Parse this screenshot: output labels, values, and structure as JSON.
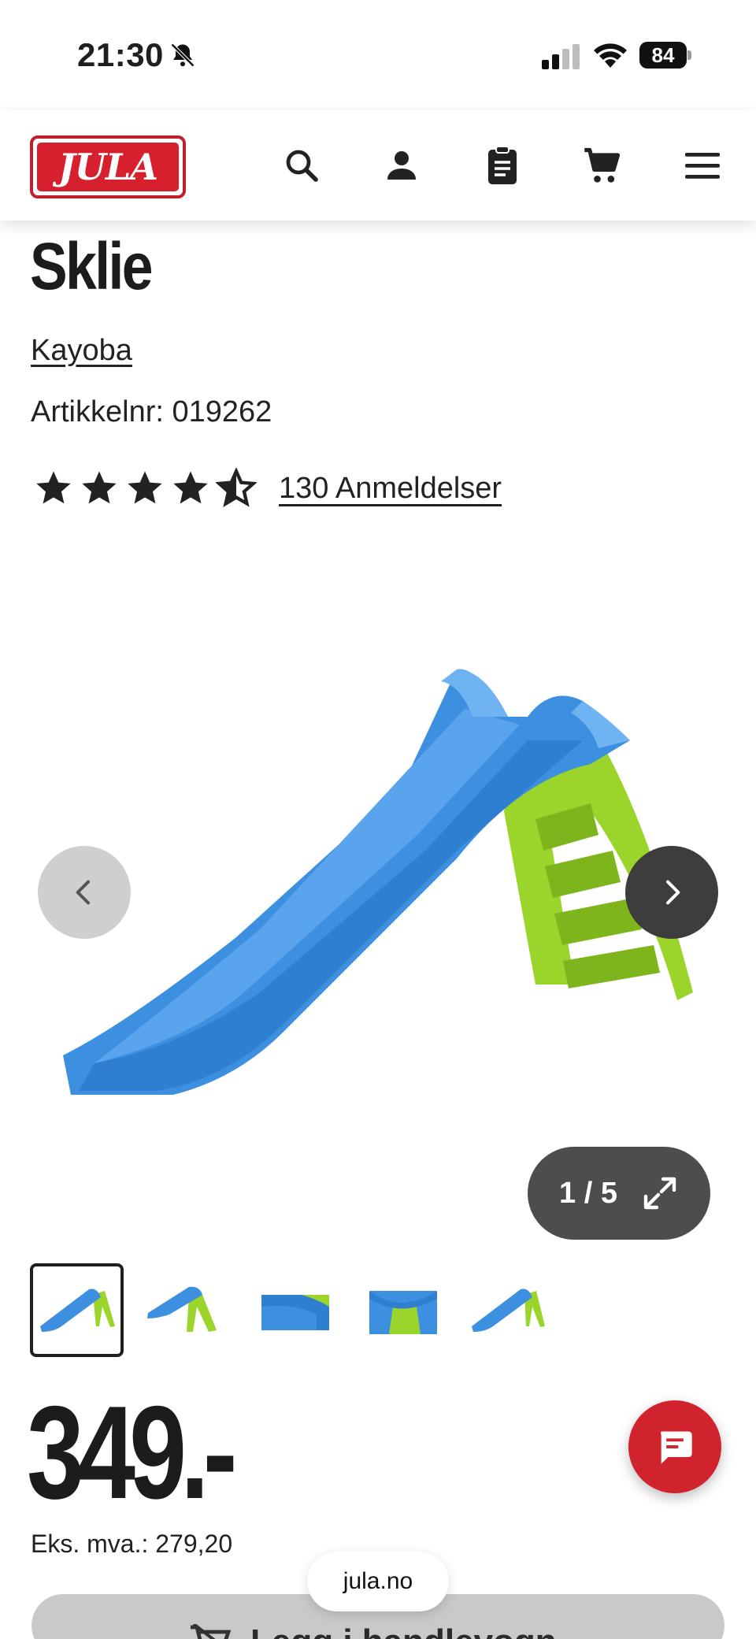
{
  "status_bar": {
    "time": "21:30",
    "battery": "84"
  },
  "header": {
    "logo_text": "JULA",
    "icons": [
      "search-icon",
      "account-icon",
      "clipboard-icon",
      "cart-icon",
      "menu-icon"
    ]
  },
  "product": {
    "title": "Sklie",
    "brand": "Kayoba",
    "article_number": "Artikkelnr: 019262",
    "rating_value": 4.5,
    "rating_max": 5,
    "reviews_label": "130 Anmeldelser",
    "price": "349.-",
    "vat_label": "Eks. mva.: 279,20"
  },
  "gallery": {
    "counter": "1 / 5",
    "current_index": 1,
    "total": 5
  },
  "cart": {
    "label": "Legg i handlevogn"
  },
  "browser": {
    "url": "jula.no"
  },
  "colors": {
    "brand_red": "#d1232e",
    "slide_blue": "#3d8fe0",
    "ladder_green": "#9bd42a"
  }
}
